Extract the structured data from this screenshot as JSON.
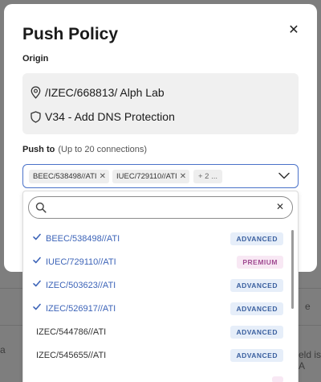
{
  "modal": {
    "title": "Push Policy",
    "close_icon": "close-icon",
    "origin": {
      "label": "Origin",
      "location_text": "/IZEC/668813/ Alph Lab",
      "location_icon": "location-pin-icon",
      "policy_text": "V34 - Add DNS Protection",
      "policy_icon": "shield-icon"
    },
    "push_to": {
      "label": "Push to",
      "hint": "(Up to 20 connections)",
      "chips": [
        {
          "label": "BEEC/538498//ATI"
        },
        {
          "label": "IUEC/729110//ATI"
        }
      ],
      "more_label": "+ 2 ..."
    }
  },
  "dropdown": {
    "search": {
      "value": "",
      "placeholder": ""
    },
    "options": [
      {
        "name": "BEEC/538498//ATI",
        "badge": "ADVANCED",
        "selected": true
      },
      {
        "name": "IUEC/729110//ATI",
        "badge": "PREMIUM",
        "selected": true
      },
      {
        "name": "IZEC/503623//ATI",
        "badge": "ADVANCED",
        "selected": true
      },
      {
        "name": "IZEC/526917//ATI",
        "badge": "ADVANCED",
        "selected": true
      },
      {
        "name": "IZEC/544786//ATI",
        "badge": "ADVANCED",
        "selected": false
      },
      {
        "name": "IZEC/545655//ATI",
        "badge": "ADVANCED",
        "selected": false
      }
    ]
  },
  "background": {
    "fragment_left": "a",
    "fragment_right": "eld is A"
  },
  "colors": {
    "accent": "#4a72c9",
    "selected_text": "#3d64b8",
    "advanced_bg": "#e6eef9",
    "premium_bg": "#f8e8f4"
  }
}
